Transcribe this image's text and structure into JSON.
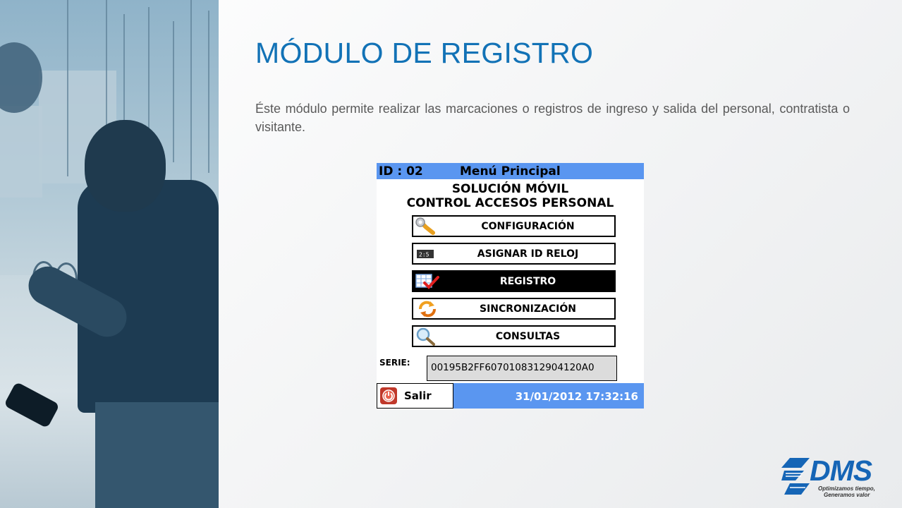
{
  "slide": {
    "title": "MÓDULO DE REGISTRO",
    "description": "Éste módulo permite realizar las marcaciones o registros de ingreso y salida del personal, contratista o visitante."
  },
  "device": {
    "id_label": "ID : 02",
    "menu_title": "Menú Principal",
    "heading_line1": "SOLUCIÓN MÓVIL",
    "heading_line2": "CONTROL ACCESOS PERSONAL",
    "menu_items": [
      {
        "label": "CONFIGURACIÓN",
        "icon": "wrench-icon",
        "selected": false
      },
      {
        "label": "ASIGNAR ID RELOJ",
        "icon": "clock-id-icon",
        "selected": false
      },
      {
        "label": "REGISTRO",
        "icon": "calendar-check-icon",
        "selected": true
      },
      {
        "label": "SINCRONIZACIÓN",
        "icon": "sync-icon",
        "selected": false
      },
      {
        "label": "CONSULTAS",
        "icon": "magnifier-icon",
        "selected": false
      }
    ],
    "serie_label": "SERIE:",
    "serie_value": "00195B2FF6070108312904120A0",
    "exit_label": "Salir",
    "datetime": "31/01/2012  17:32:16",
    "accent_color": "#5a96f0"
  },
  "logo": {
    "text": "DMS",
    "tagline1": "Optimizamos tiempo,",
    "tagline2": "Generamos valor",
    "color": "#1565b6"
  }
}
